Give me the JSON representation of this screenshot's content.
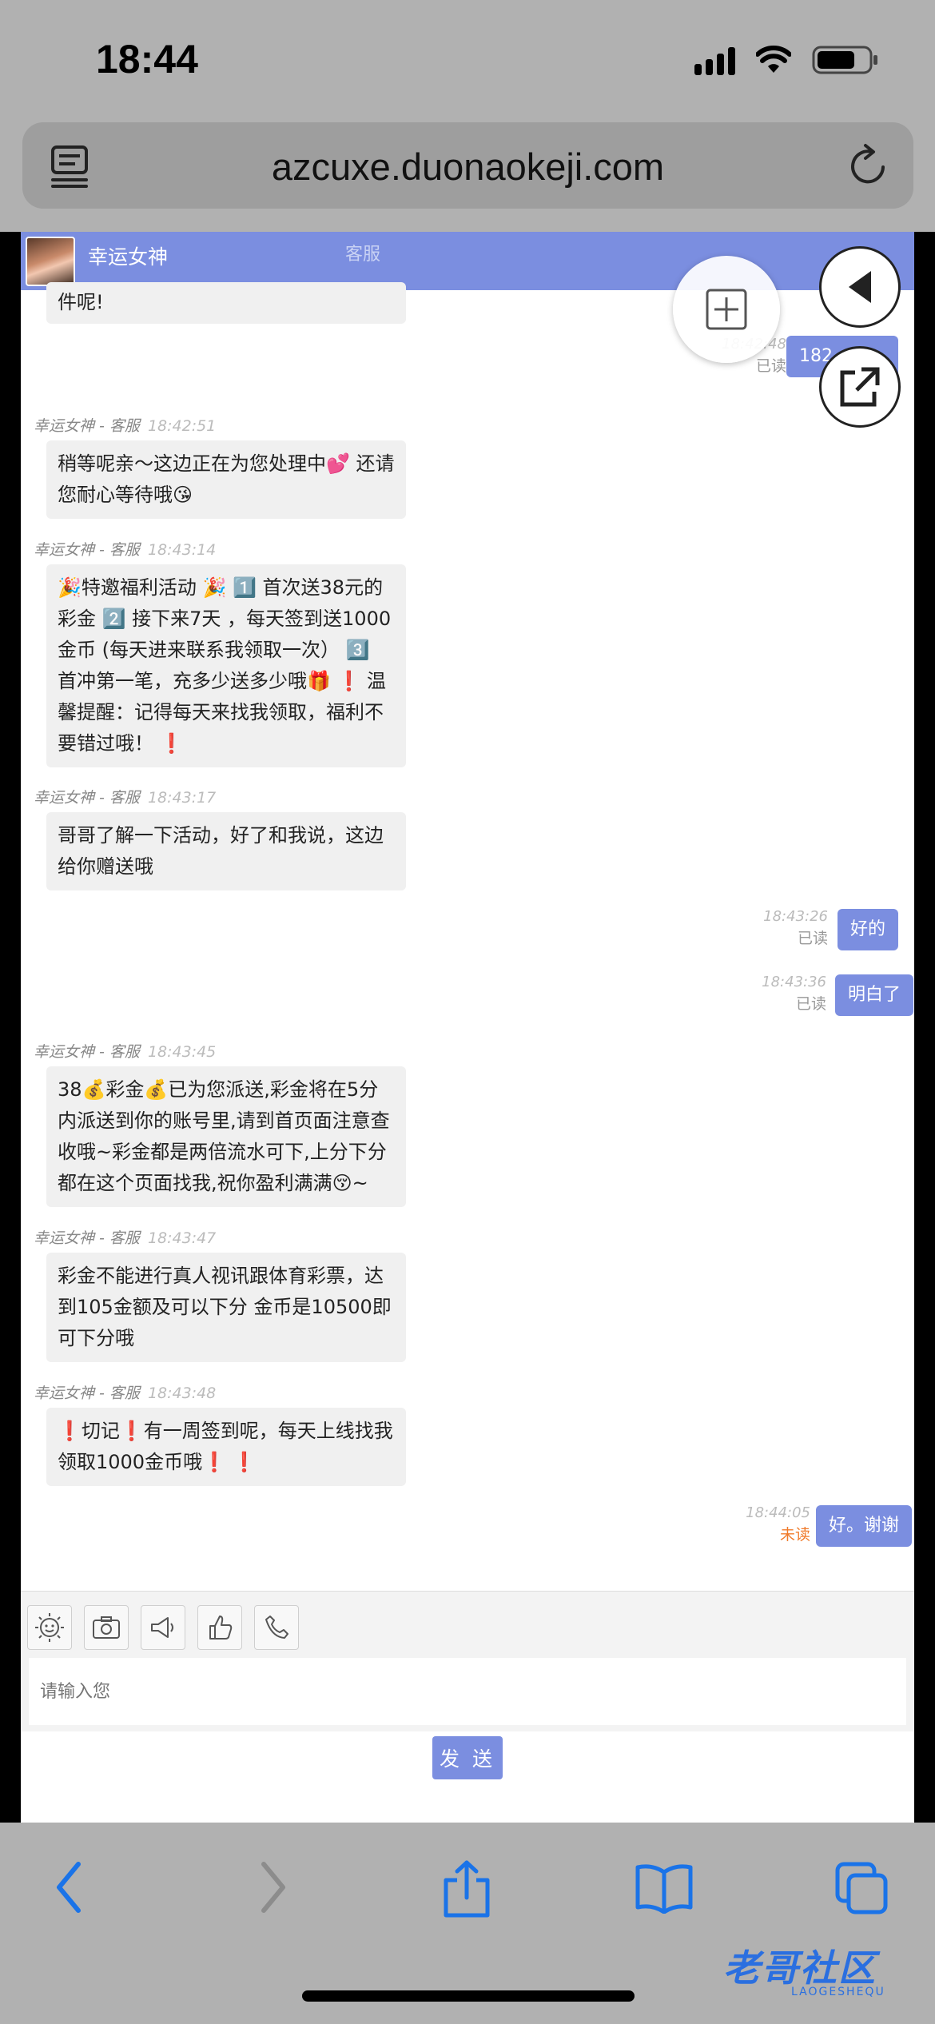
{
  "status_bar": {
    "time": "18:44"
  },
  "browser": {
    "url": "azcuxe.duonaokeji.com"
  },
  "chat": {
    "header_title": "幸运女神",
    "header_role": "客服",
    "input_placeholder": "请输入您",
    "send_label": "发 送",
    "messages": [
      {
        "text": "件呢!"
      },
      {
        "sender": "幸运女神 - 客服",
        "time": "18:42:51",
        "text": "稍等呢亲～这边正在为您处理中💕 还请您耐心等待哦😘"
      },
      {
        "sender": "幸运女神 - 客服",
        "time": "18:43:14",
        "text": "🎉特邀福利活动 🎉 1️⃣ 首次送38元的彩金 2️⃣ 接下来7天 ，每天签到送1000金币 (每天进来联系我领取一次） 3️⃣ 首冲第一笔，充多少送多少哦🎁 ❗ 温馨提醒：记得每天来找我领取，福利不要错过哦！ ❗"
      },
      {
        "sender": "幸运女神 - 客服",
        "time": "18:43:17",
        "text": "哥哥了解一下活动，好了和我说，这边给你赠送哦"
      },
      {
        "sender": "幸运女神 - 客服",
        "time": "18:43:45",
        "text": "38💰彩金💰已为您派送,彩金将在5分内派送到你的账号里,请到首页面注意查收哦~彩金都是两倍流水可下,上分下分都在这个页面找我,祝你盈利满满😚~"
      },
      {
        "sender": "幸运女神 - 客服",
        "time": "18:43:47",
        "text": "彩金不能进行真人视讯跟体育彩票，达到105金额及可以下分 金币是10500即可下分哦"
      },
      {
        "sender": "幸运女神 - 客服",
        "time": "18:43:48",
        "text": "❗切记❗有一周签到呢，每天上线找我领取1000金币哦❗ ❗"
      }
    ],
    "my_messages": [
      {
        "time": "18:42:48",
        "status": "已读",
        "text": "182"
      },
      {
        "time": "18:43:26",
        "status": "已读",
        "text": "好的"
      },
      {
        "time": "18:43:36",
        "status": "已读",
        "text": "明白了"
      },
      {
        "time": "18:44:05",
        "status": "未读",
        "text": "好。谢谢"
      }
    ]
  },
  "watermark": {
    "text": "老哥社区",
    "sub": "LAOGESHEQU"
  }
}
